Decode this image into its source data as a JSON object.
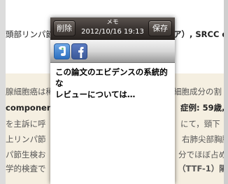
{
  "article": {
    "line1": "頭部リンパ節",
    "line1_tail": "ア）, SRCC d",
    "line2_left": "腺細胞癌は稀",
    "line2_right": "細胞成分の割",
    "line3_left": "component)",
    "line3_right_label": "症例",
    "line3_right_tail": ": 59歳,",
    "line4_left": "を主訴に呼",
    "line4_right": "にて，頸下",
    "line5_left": "上リンパ節",
    "line5_right": "右肺尖部胸膜",
    "line6_left": "パ節生検お",
    "line6_right": "分でほぼ占め",
    "line7_left": "学的検査で",
    "line7_right": "（TTF-1）陽性"
  },
  "memo": {
    "title": "メモ",
    "datetime": "2012/10/16 19:13",
    "delete_label": "削除",
    "save_label": "保存",
    "body": "この論文のエビデンスの系統的な\nレビューについては…"
  },
  "share": {
    "icons": [
      "evernote-icon",
      "facebook-icon"
    ]
  },
  "colors": {
    "header_dark": "#3a3431",
    "article_highlight": "#f5efe1",
    "facebook_blue": "#3b5998",
    "evernote_blue": "#2b6fc0"
  }
}
